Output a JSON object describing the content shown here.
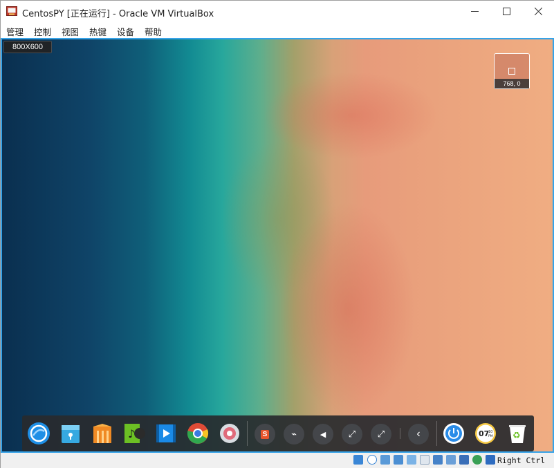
{
  "window": {
    "title": "CentosPY [正在运行] - Oracle VM VirtualBox",
    "controls": [
      "minimize",
      "maximize",
      "close"
    ]
  },
  "menubar": {
    "items": [
      "管理",
      "控制",
      "视图",
      "热键",
      "设备",
      "帮助"
    ]
  },
  "vm": {
    "resolution_badge": "800X600",
    "mini_preview_coord": "768, 0"
  },
  "dock": {
    "apps": [
      {
        "name": "launcher",
        "icon": "deepin-launcher-icon",
        "color": "#1e8fe6"
      },
      {
        "name": "file-manager",
        "icon": "folder-icon",
        "color": "#36a9e1"
      },
      {
        "name": "app-store",
        "icon": "store-icon",
        "color": "#f08a24"
      },
      {
        "name": "music",
        "icon": "music-icon",
        "color": "#6cc024"
      },
      {
        "name": "movie",
        "icon": "movie-icon",
        "color": "#1a8ae6"
      },
      {
        "name": "chrome",
        "icon": "chrome-icon",
        "color": "#e04b36"
      },
      {
        "name": "settings",
        "icon": "settings-icon",
        "color": "#e06a7a"
      }
    ],
    "tray": [
      {
        "name": "sogou-input",
        "icon": "input-method-icon",
        "glyph": "S"
      },
      {
        "name": "usb",
        "icon": "usb-icon",
        "glyph": "⌁"
      },
      {
        "name": "sound",
        "icon": "volume-icon",
        "glyph": "◀"
      },
      {
        "name": "network-1",
        "icon": "network-icon",
        "glyph": "⤢"
      },
      {
        "name": "network-2",
        "icon": "network-icon",
        "glyph": "⤢"
      },
      {
        "name": "collapse",
        "icon": "chevron-left-icon",
        "glyph": "‹"
      }
    ],
    "system": [
      {
        "name": "power",
        "icon": "power-icon",
        "color": "#2a8ce8"
      },
      {
        "name": "clock",
        "icon": "clock-icon",
        "color": "#f5c842",
        "time_hour": "07",
        "time_minute": "10",
        "period": "PM"
      },
      {
        "name": "trash",
        "icon": "trash-icon",
        "color": "#ffffff"
      }
    ]
  },
  "statusbar": {
    "host_key": "Right Ctrl",
    "icons": [
      "hard-disk-icon",
      "optical-drive-icon",
      "audio-icon",
      "network-icon",
      "usb-icon",
      "shared-folders-icon",
      "display-icon",
      "video-capture-icon",
      "virtualization-icon",
      "mouse-integration-icon",
      "arrow-down-icon"
    ]
  },
  "colors": {
    "vm_border": "#36a3e8",
    "dock_bg": "#282a2e"
  }
}
